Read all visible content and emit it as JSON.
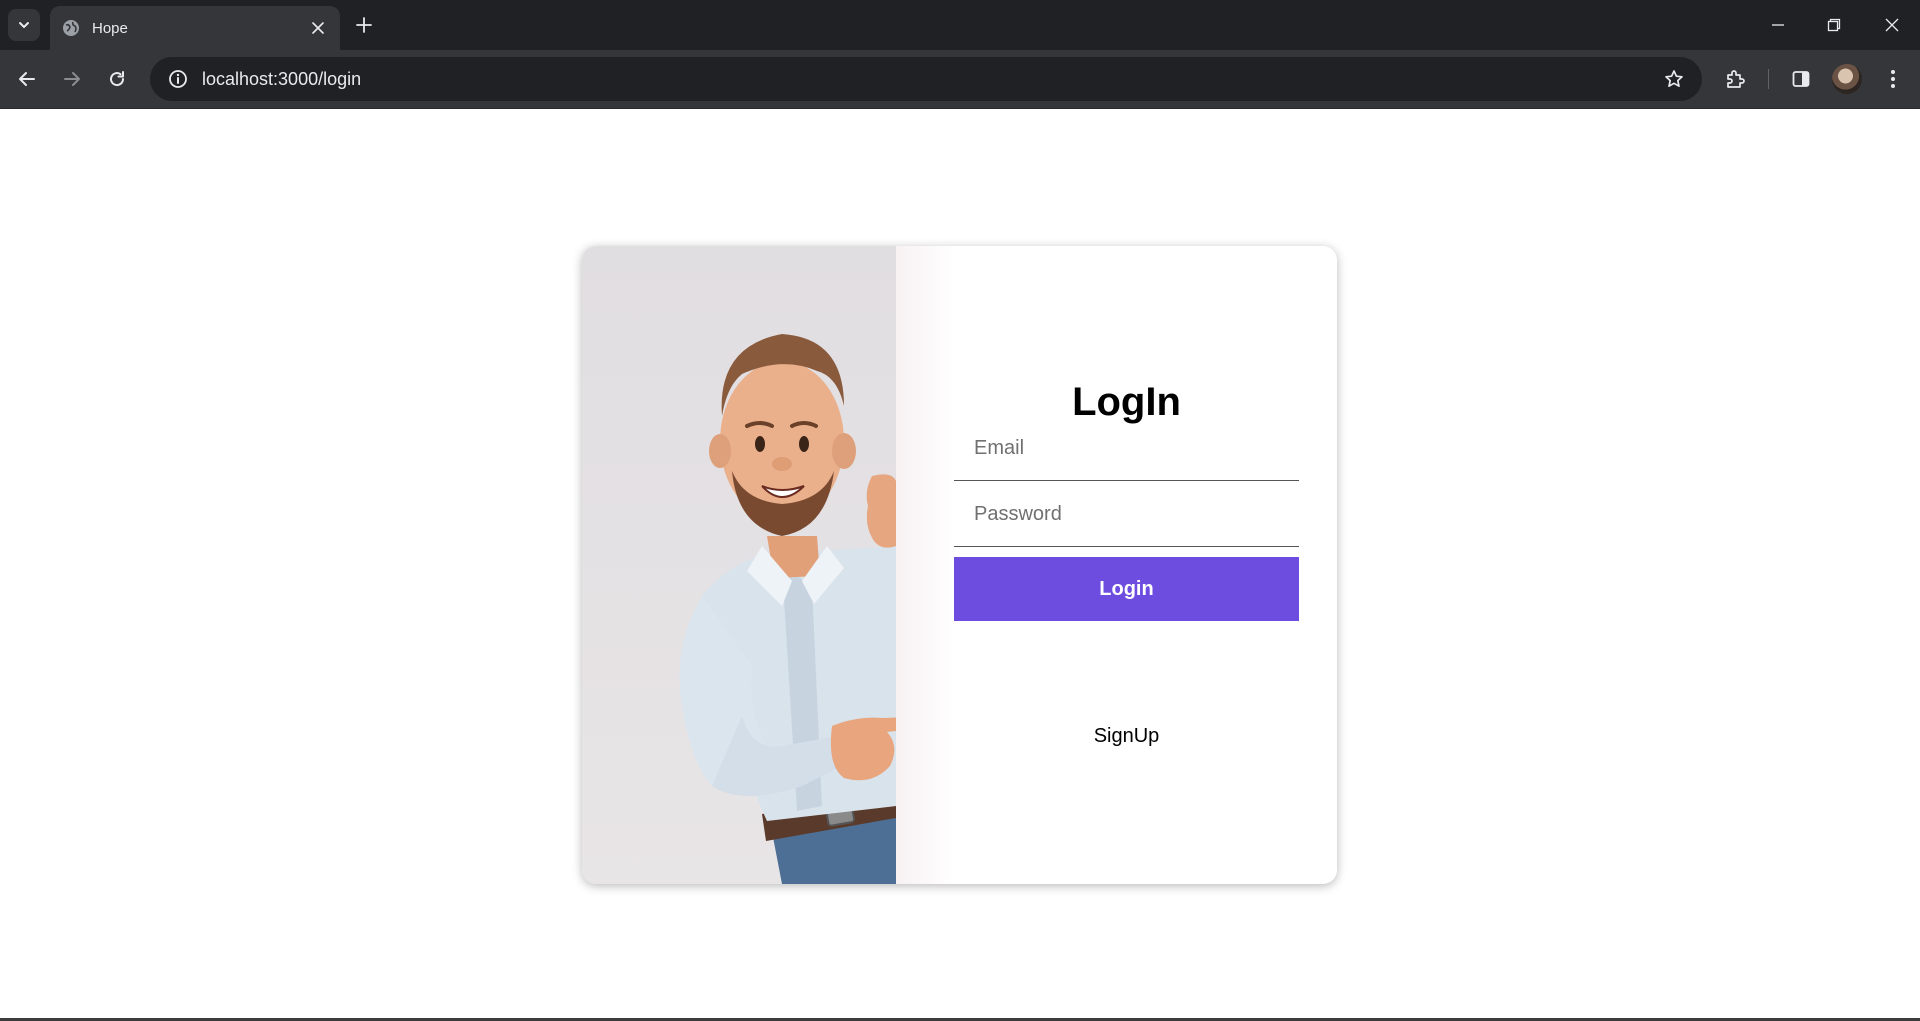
{
  "browser": {
    "tab_title": "Hope",
    "url": "localhost:3000/login",
    "icons": {
      "tab_search": "chevron-down-icon",
      "favicon": "globe-icon",
      "tab_close": "close-icon",
      "new_tab": "plus-icon",
      "back": "back-arrow-icon",
      "forward": "forward-arrow-icon",
      "reload": "reload-icon",
      "site_info": "info-icon",
      "bookmark": "star-icon",
      "extensions": "puzzle-icon",
      "side_panel": "side-panel-icon",
      "profile": "avatar",
      "menu": "kebab-menu-icon",
      "minimize": "minimize-icon",
      "restore": "restore-icon",
      "close_window": "close-icon"
    }
  },
  "login": {
    "heading": "LogIn",
    "email_placeholder": "Email",
    "password_placeholder": "Password",
    "submit_label": "Login",
    "signup_label": "SignUp"
  },
  "colors": {
    "accent": "#6c4de0",
    "chrome_dark": "#202124",
    "chrome_toolbar": "#35363a",
    "illustration_bg": "#e3e0e3"
  },
  "illustration": {
    "subject": "cartoon man in light blue shirt peeking from behind wall, pointing right"
  }
}
